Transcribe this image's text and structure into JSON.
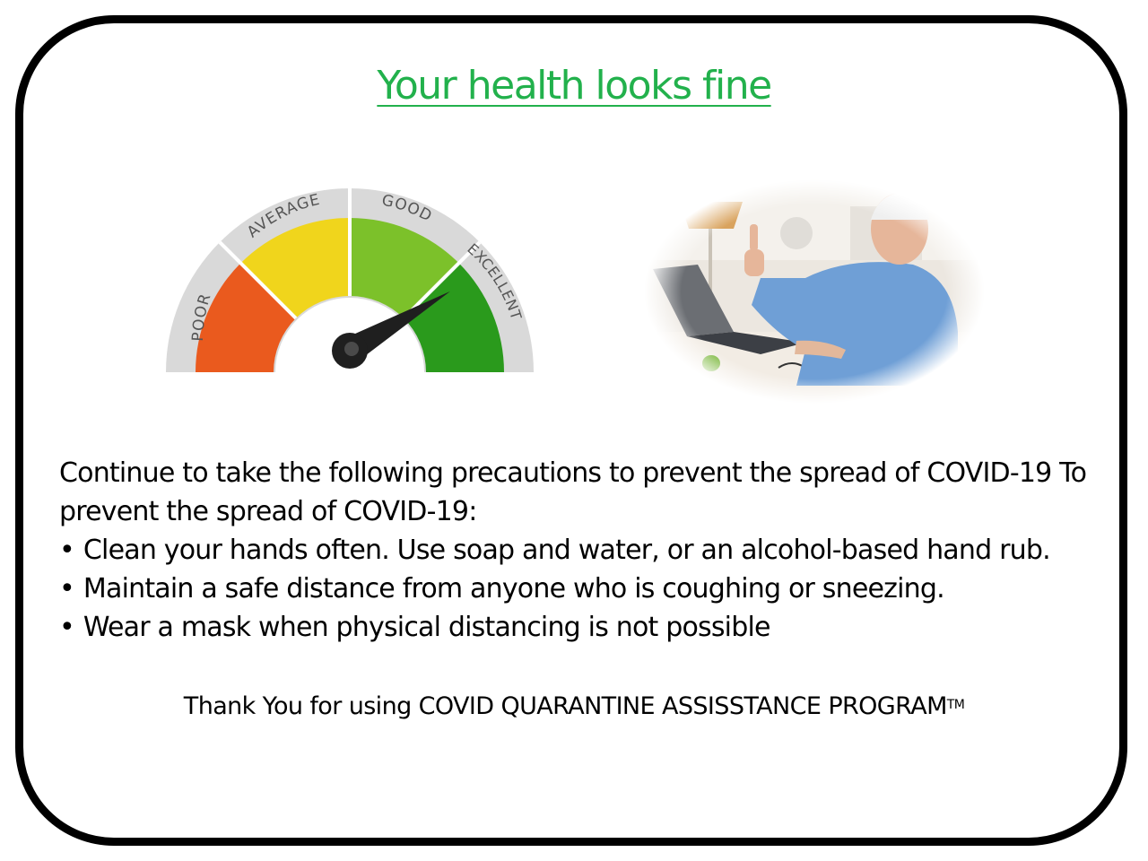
{
  "page": {
    "title": "Your health looks fine",
    "title_color": "#22b14c",
    "frame_color": "#000000"
  },
  "gauge": {
    "labels": {
      "poor": "POOR",
      "average": "AVERAGE",
      "good": "GOOD",
      "excellent": "EXCELLENT"
    },
    "level_fraction": 0.83,
    "colors": {
      "poor": "#ea5a1e",
      "average": "#f0d51c",
      "good": "#7cc12a",
      "excellent": "#2a9a1c",
      "rim": "#d9d9d9",
      "needle": "#1f1f1f"
    }
  },
  "photo": {
    "subject": "man-thumbs-up-at-laptop"
  },
  "message": {
    "intro": "Continue to take the following precautions to prevent the spread of COVID-19 To prevent the spread of COVID-19:",
    "bullet_glyph": "•",
    "bullets": [
      "Clean your hands often. Use soap and water, or an alcohol-based hand rub.",
      "Maintain a safe distance from anyone who is coughing or sneezing.",
      "Wear a mask when physical distancing is not possible"
    ]
  },
  "footer": {
    "text": "Thank You for using COVID QUARANTINE ASSISSTANCE PROGRAM",
    "trademark": "TM"
  }
}
